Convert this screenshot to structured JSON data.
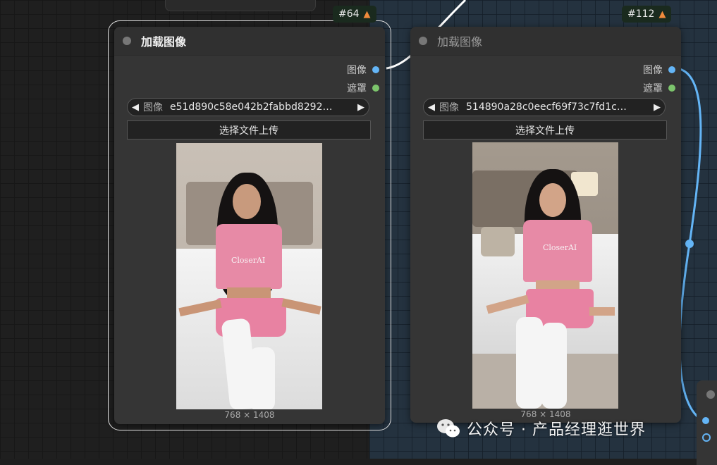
{
  "nodes": [
    {
      "id_badge": "#64",
      "title": "加载图像",
      "outputs": [
        "图像",
        "遮罩"
      ],
      "image_label": "图像",
      "image_value": "e51d890c58e042b2fabbd8292…",
      "upload_label": "选择文件上传",
      "dimensions": "768 × 1408",
      "shirt_text": "CloserAI"
    },
    {
      "id_badge": "#112",
      "title": "加载图像",
      "outputs": [
        "图像",
        "遮罩"
      ],
      "image_label": "图像",
      "image_value": "514890a28c0eecf69f73c7fd1c…",
      "upload_label": "选择文件上传",
      "dimensions": "768 × 1408",
      "shirt_text": "CloserAI"
    }
  ],
  "watermark": {
    "text": "公众号 · 产品经理逛世界"
  },
  "colors": {
    "image_slot": "#64b5f6",
    "mask_slot": "#7cc46c",
    "wire_image": "#64b5f6",
    "wire_white": "#ffffff",
    "badge_bg": "#1a2a1e",
    "node_bg": "#353535"
  }
}
